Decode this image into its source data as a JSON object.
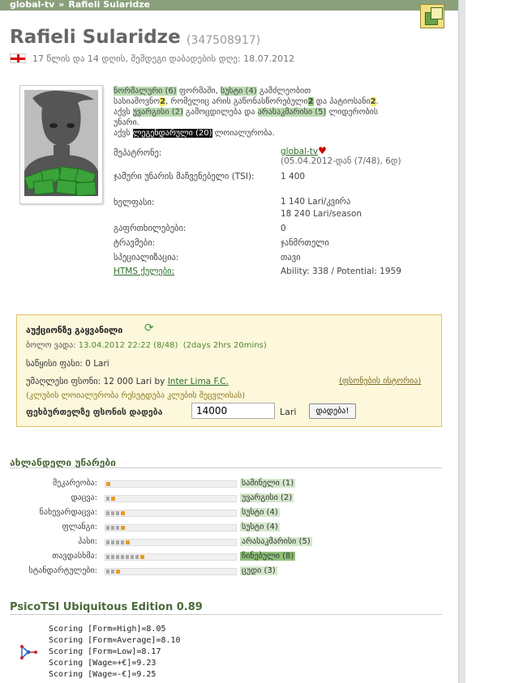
{
  "breadcrumb": {
    "team": "global-tv",
    "separator": "»",
    "player": "Rafieli Sularidze"
  },
  "player": {
    "name": "Rafieli Sularidze",
    "id": "(347508917)",
    "age_line": "17 წლის და 14 დღის, შემდეგი დაბადების დღე: 18.07.2012"
  },
  "summary": {
    "form": "ნორმალური (6)",
    "t1": " ფორმაში, ",
    "stamina": "სუსტი (4)",
    "t2": " გამძლეობით",
    "t3": "სასიამოვნო",
    "num1": "2",
    "t4": ", რომელიც არის გაწონასწორებული",
    "num2": "2",
    "t5": " და პატიოსანი",
    "num3": "2",
    "t6": ".",
    "t7": "აქვს ",
    "experience": "უვარგისი (2)",
    "t8": " გამოცდილება და ",
    "leadership": "არასაკმარისი (5)",
    "t9": " ლიდერობის",
    "t10": "უნარი.",
    "t11": "აქვს ",
    "loyalty": "ლეგენდარული (20)",
    "t12": " ლოიალურობა."
  },
  "details": {
    "owner_label": "მეპატრონე:",
    "owner_team": "global-tv",
    "owner_since": "(05.04.2012-დან (7/48), 6დ)",
    "tsi_label": "ჯამური უნარის მაჩვენებელი (TSI):",
    "tsi_value": "1 400",
    "wage_label": "ხელფასი:",
    "wage_week": "1 140 Lari/კვირა",
    "wage_season": "18 240 Lari/season",
    "warnings_label": "გაფრთხილებები:",
    "warnings_value": "0",
    "injuries_label": "ტრავმები:",
    "injuries_value": "ჯანმრთელი",
    "specialty_label": "სპეციალიზაცია:",
    "specialty_value": "თავი",
    "htms_label": "HTMS ქულები:",
    "htms_value": "Ability: 338 / Potential: 1959"
  },
  "auction": {
    "title": "აუქციონზე გაყვანილი",
    "last_label": "ბოლო ვადა: ",
    "deadline": "13.04.2012 22:22 (8/48)",
    "remaining": "(2days 2hrs 20mins)",
    "start_price": "საწყისი ფასი: 0 Lari",
    "highest_prefix": "უმაღლესი ფსონი: 12 000 Lari by ",
    "highest_team": "Inter Lima F.C.",
    "history_link": "(ფსონების ისტორია)",
    "note": "(კლუბის ლოიალურობა რესეტდება კლუბის შეცვლისას)",
    "bid_label": "ფეხბურთელზე ფსონის დადება",
    "bid_value": "14000",
    "currency": "Lari",
    "bid_button": "დადება!"
  },
  "skills": {
    "heading": "ახლანდელი უნარები",
    "items": [
      {
        "label": "მეკარეობა:",
        "value": "სამინელი (1)",
        "level": 1,
        "highlight": false
      },
      {
        "label": "დაცვა:",
        "value": "უვარგისი (2)",
        "level": 2,
        "highlight": false
      },
      {
        "label": "ნახევარდაცვა:",
        "value": "სუსტი (4)",
        "level": 4,
        "highlight": false
      },
      {
        "label": "ფლანგი:",
        "value": "სუსტი (4)",
        "level": 4,
        "highlight": false
      },
      {
        "label": "პასი:",
        "value": "არასაკმარისი (5)",
        "level": 5,
        "highlight": false
      },
      {
        "label": "თავდასხმა:",
        "value": "ჩინებული (8)",
        "level": 8,
        "highlight": true
      },
      {
        "label": "სტანდარტულები:",
        "value": "ცუდი (3)",
        "level": 3,
        "highlight": false
      }
    ]
  },
  "psicotsi": {
    "title": "PsicoTSI Ubiquitous Edition 0.89",
    "lines": [
      "Scoring [Form=High]=8.05",
      "Scoring [Form=Average]=8.10",
      "Scoring [Form=Low]=8.17",
      "Scoring [Wage=+€]=9.23",
      "Scoring [Wage=-€]=9.25"
    ]
  },
  "colors": {
    "topbar": "#8aa07c",
    "accent_green": "#4a6a3a",
    "auction_bg": "#fdf7dc",
    "skill_tip": "#e89a2a",
    "highlight_green": "#b9dbb0"
  }
}
